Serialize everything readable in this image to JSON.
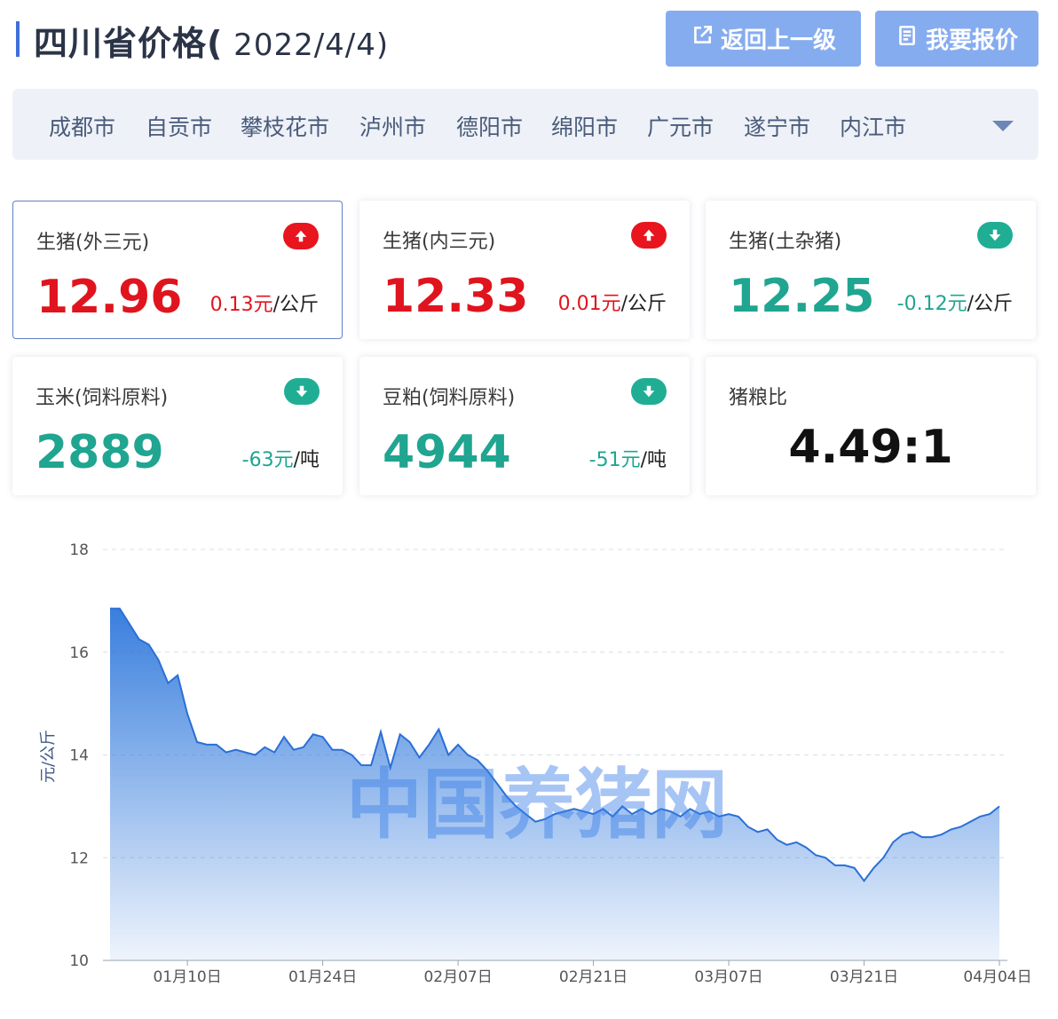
{
  "header": {
    "title": "四川省价格(",
    "date": " 2022/4/4)",
    "back_button": "返回上一级",
    "quote_button": "我要报价"
  },
  "cities": [
    "成都市",
    "自贡市",
    "攀枝花市",
    "泸州市",
    "德阳市",
    "绵阳市",
    "广元市",
    "遂宁市",
    "内江市"
  ],
  "cards": [
    {
      "label": "生猪(外三元)",
      "value": "12.96",
      "change": "0.13元",
      "unit": "/公斤",
      "trend": "up"
    },
    {
      "label": "生猪(内三元)",
      "value": "12.33",
      "change": "0.01元",
      "unit": "/公斤",
      "trend": "up"
    },
    {
      "label": "生猪(土杂猪)",
      "value": "12.25",
      "change": "-0.12元",
      "unit": "/公斤",
      "trend": "down"
    },
    {
      "label": "玉米(饲料原料)",
      "value": "2889",
      "change": "-63元",
      "unit": "/吨",
      "trend": "down"
    },
    {
      "label": "豆粕(饲料原料)",
      "value": "4944",
      "change": "-51元",
      "unit": "/吨",
      "trend": "down"
    },
    {
      "label": "猪粮比",
      "value": "4.49:1"
    }
  ],
  "colors": {
    "up": "#e0141e",
    "down": "#1fa590",
    "accent": "#3a7ee8",
    "button": "#86acf0"
  },
  "chart_data": {
    "type": "area",
    "title": "",
    "xlabel": "",
    "ylabel": "元/公斤",
    "ylim": [
      10,
      18
    ],
    "yticks": [
      10,
      12,
      14,
      16,
      18
    ],
    "xtick_labels": [
      "01月10日",
      "01月24日",
      "02月07日",
      "02月21日",
      "03月07日",
      "03月21日",
      "04月04日"
    ],
    "grid": true,
    "watermark": "中国养猪网",
    "x": [
      "2022-01-02",
      "2022-01-03",
      "2022-01-04",
      "2022-01-05",
      "2022-01-06",
      "2022-01-07",
      "2022-01-08",
      "2022-01-09",
      "2022-01-10",
      "2022-01-11",
      "2022-01-12",
      "2022-01-13",
      "2022-01-14",
      "2022-01-15",
      "2022-01-16",
      "2022-01-17",
      "2022-01-18",
      "2022-01-19",
      "2022-01-20",
      "2022-01-21",
      "2022-01-22",
      "2022-01-23",
      "2022-01-24",
      "2022-01-25",
      "2022-01-26",
      "2022-01-27",
      "2022-01-28",
      "2022-01-29",
      "2022-01-30",
      "2022-01-31",
      "2022-02-01",
      "2022-02-02",
      "2022-02-03",
      "2022-02-04",
      "2022-02-05",
      "2022-02-06",
      "2022-02-07",
      "2022-02-08",
      "2022-02-09",
      "2022-02-10",
      "2022-02-11",
      "2022-02-12",
      "2022-02-13",
      "2022-02-14",
      "2022-02-15",
      "2022-02-16",
      "2022-02-17",
      "2022-02-18",
      "2022-02-19",
      "2022-02-20",
      "2022-02-21",
      "2022-02-22",
      "2022-02-23",
      "2022-02-24",
      "2022-02-25",
      "2022-02-26",
      "2022-02-27",
      "2022-02-28",
      "2022-03-01",
      "2022-03-02",
      "2022-03-03",
      "2022-03-04",
      "2022-03-05",
      "2022-03-06",
      "2022-03-07",
      "2022-03-08",
      "2022-03-09",
      "2022-03-10",
      "2022-03-11",
      "2022-03-12",
      "2022-03-13",
      "2022-03-14",
      "2022-03-15",
      "2022-03-16",
      "2022-03-17",
      "2022-03-18",
      "2022-03-19",
      "2022-03-20",
      "2022-03-21",
      "2022-03-22",
      "2022-03-23",
      "2022-03-24",
      "2022-03-25",
      "2022-03-26",
      "2022-03-27",
      "2022-03-28",
      "2022-03-29",
      "2022-03-30",
      "2022-03-31",
      "2022-04-01",
      "2022-04-02",
      "2022-04-03",
      "2022-04-04"
    ],
    "values": [
      16.85,
      16.85,
      16.55,
      16.25,
      16.15,
      15.85,
      15.4,
      15.55,
      14.8,
      14.25,
      14.2,
      14.2,
      14.05,
      14.1,
      14.05,
      14.0,
      14.15,
      14.05,
      14.35,
      14.1,
      14.15,
      14.4,
      14.35,
      14.1,
      14.1,
      14.0,
      13.8,
      13.8,
      14.45,
      13.75,
      14.4,
      14.25,
      13.95,
      14.2,
      14.5,
      14.0,
      14.2,
      14.0,
      13.9,
      13.7,
      13.45,
      13.2,
      13.0,
      12.85,
      12.7,
      12.75,
      12.85,
      12.9,
      12.95,
      12.9,
      12.85,
      12.95,
      12.8,
      13.0,
      12.85,
      12.95,
      12.85,
      12.95,
      12.9,
      12.8,
      12.95,
      12.85,
      12.9,
      12.8,
      12.85,
      12.8,
      12.6,
      12.5,
      12.55,
      12.35,
      12.25,
      12.3,
      12.2,
      12.05,
      12.0,
      11.85,
      11.85,
      11.8,
      11.55,
      11.8,
      12.0,
      12.3,
      12.45,
      12.5,
      12.4,
      12.4,
      12.45,
      12.55,
      12.6,
      12.7,
      12.8,
      12.85,
      13.0
    ]
  }
}
